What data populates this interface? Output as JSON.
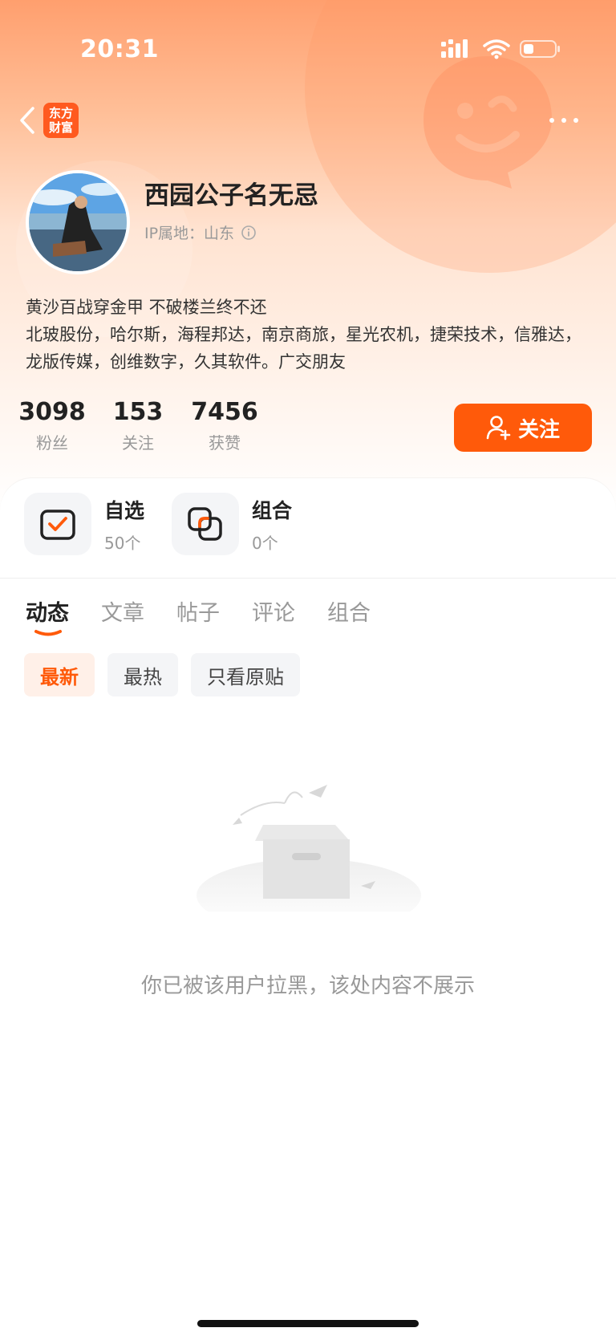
{
  "status_bar": {
    "time": "20:31"
  },
  "nav": {
    "app_logo_text": "东方财富"
  },
  "profile": {
    "username": "西园公子名无忌",
    "ip_label": "IP属地：山东",
    "bio_line1": "黄沙百战穿金甲 不破楼兰终不还",
    "bio_line2": "北玻股份，哈尔斯，海程邦达，南京商旅，星光农机，捷荣技术，信雅达，龙版传媒，创维数字，久其软件。广交朋友"
  },
  "stats": [
    {
      "value": "3098",
      "label": "粉丝"
    },
    {
      "value": "153",
      "label": "关注"
    },
    {
      "value": "7456",
      "label": "获赞"
    }
  ],
  "follow_button": {
    "label": "关注"
  },
  "quick_links": [
    {
      "title": "自选",
      "sub": "50个"
    },
    {
      "title": "组合",
      "sub": "0个"
    }
  ],
  "tabs": [
    "动态",
    "文章",
    "帖子",
    "评论",
    "组合"
  ],
  "filters": [
    "最新",
    "最热",
    "只看原贴"
  ],
  "empty_state": {
    "message": "你已被该用户拉黑，该处内容不展示"
  },
  "colors": {
    "accent": "#ff5a0a",
    "header_gradient_top": "#ff9f6e"
  }
}
